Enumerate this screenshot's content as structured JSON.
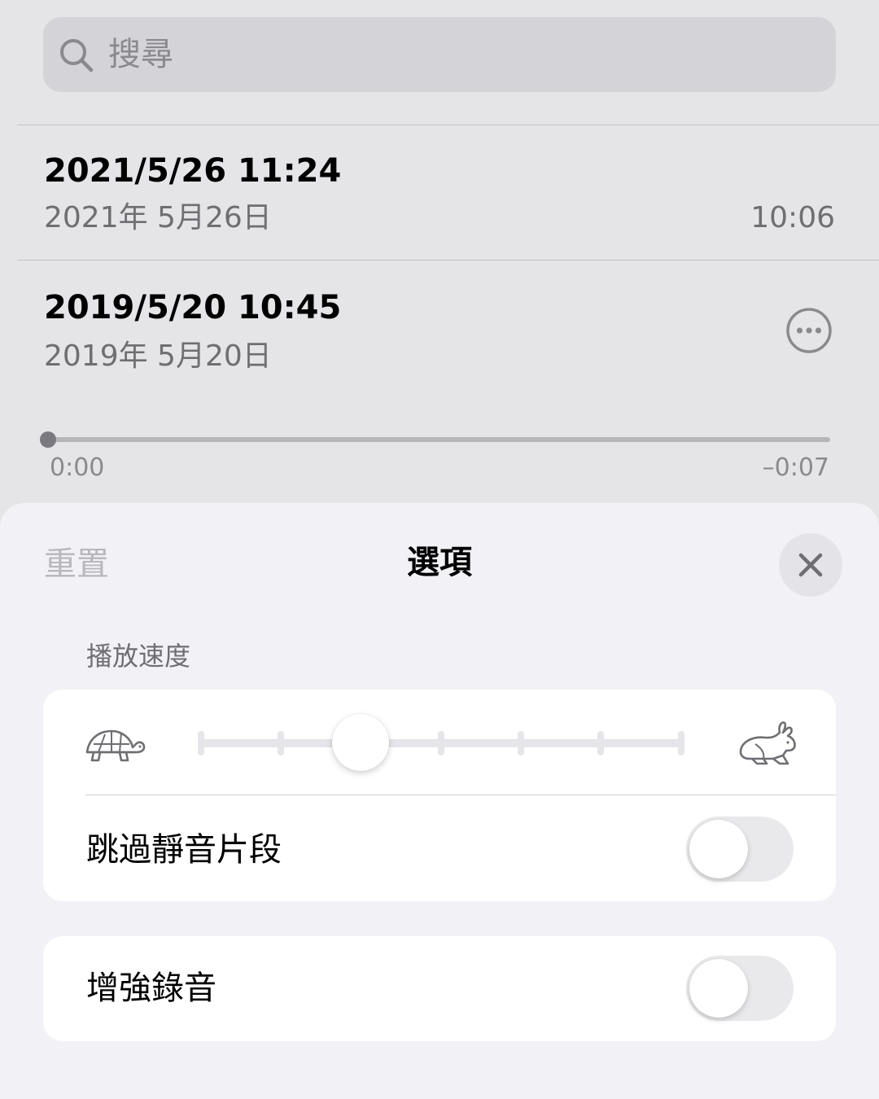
{
  "search": {
    "placeholder": "搜尋",
    "icon": "search-icon"
  },
  "recordings": [
    {
      "title": "2021/5/26 11:24",
      "date": "2021年 5月26日",
      "duration": "10:06"
    },
    {
      "title": "2019/5/20 10:45",
      "date": "2019年 5月20日",
      "more_icon": "ellipsis-circle-icon"
    }
  ],
  "player": {
    "progress": 0,
    "elapsed": "0:00",
    "remaining": "–0:07"
  },
  "options_sheet": {
    "reset_label": "重置",
    "title": "選項",
    "close_icon": "close-icon",
    "playback_speed": {
      "header": "播放速度",
      "slow_icon": "turtle-icon",
      "fast_icon": "rabbit-icon",
      "steps": 7,
      "selected_step": 2
    },
    "skip_silence": {
      "label": "跳過靜音片段",
      "enabled": false
    },
    "enhance_recording": {
      "label": "增強錄音",
      "enabled": false
    }
  },
  "colors": {
    "background": "#e5e5e8",
    "sheet_background": "#f2f2f6",
    "card_background": "#ffffff",
    "secondary_text": "#6e6e73",
    "disabled_text": "#b8b8bc"
  }
}
